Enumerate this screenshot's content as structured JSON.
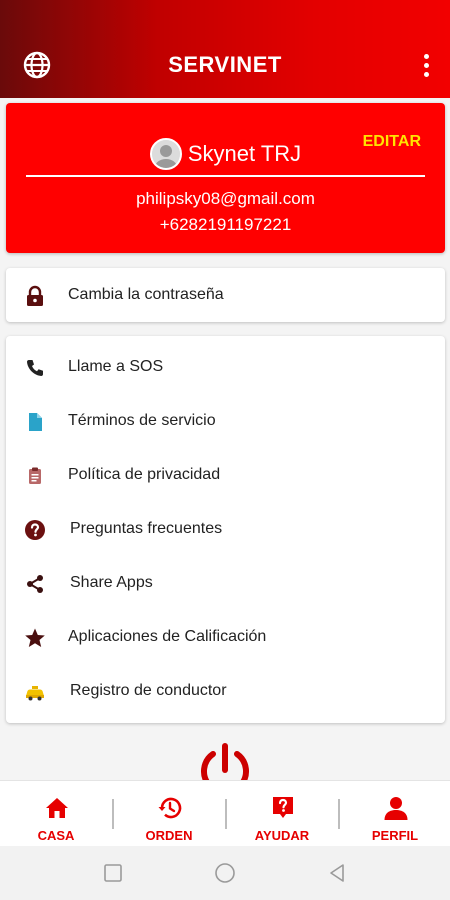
{
  "app": {
    "title": "SERVINET"
  },
  "profile": {
    "name": "Skynet TRJ",
    "edit_label": "EDITAR",
    "email": "philipsky08@gmail.com",
    "phone": "+6282191197221"
  },
  "password_item": {
    "label": "Cambia la contraseña",
    "icon": "lock-icon"
  },
  "menu": {
    "items": [
      {
        "label": "Llame a SOS",
        "icon": "phone-icon"
      },
      {
        "label": "Términos de servicio",
        "icon": "document-icon"
      },
      {
        "label": "Política de privacidad",
        "icon": "clipboard-icon"
      },
      {
        "label": "Preguntas frecuentes",
        "icon": "help-circle-icon"
      },
      {
        "label": "Share Apps",
        "icon": "share-icon"
      },
      {
        "label": "Aplicaciones de Calificación",
        "icon": "star-icon"
      },
      {
        "label": "Registro de conductor",
        "icon": "taxi-icon"
      }
    ]
  },
  "bottom_nav": {
    "items": [
      {
        "label": "CASA",
        "icon": "home-icon"
      },
      {
        "label": "ORDEN",
        "icon": "history-icon"
      },
      {
        "label": "AYUDAR",
        "icon": "help-box-icon"
      },
      {
        "label": "PERFIL",
        "icon": "person-icon"
      }
    ]
  },
  "colors": {
    "brand_red": "#ff0000",
    "accent_yellow": "#ffe400",
    "nav_red": "#e60000",
    "dark_red_icon": "#7a1a1a"
  }
}
